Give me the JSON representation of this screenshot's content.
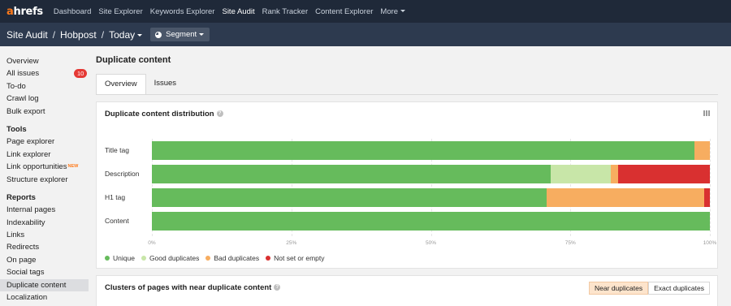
{
  "nav": {
    "logo_a": "a",
    "logo_rest": "hrefs",
    "links": [
      "Dashboard",
      "Site Explorer",
      "Keywords Explorer",
      "Site Audit",
      "Rank Tracker",
      "Content Explorer",
      "More"
    ]
  },
  "breadcrumb": {
    "root": "Site Audit",
    "project": "Hobpost",
    "date": "Today",
    "sep": "/"
  },
  "segment_label": "Segment",
  "sidebar": {
    "items": [
      "Overview",
      "All issues",
      "To-do",
      "Crawl log",
      "Bulk export"
    ],
    "issues_count": "10",
    "tools_heading": "Tools",
    "tools": [
      "Page explorer",
      "Link explorer",
      "Link opportunities",
      "Structure explorer"
    ],
    "new_tag": "NEW",
    "reports_heading": "Reports",
    "reports": [
      "Internal pages",
      "Indexability",
      "Links",
      "Redirects",
      "On page",
      "Social tags",
      "Duplicate content",
      "Localization"
    ]
  },
  "page": {
    "title": "Duplicate content",
    "tabs": [
      "Overview",
      "Issues"
    ]
  },
  "distribution": {
    "title": "Duplicate content distribution",
    "help": "?"
  },
  "chart_data": {
    "type": "bar",
    "orientation": "horizontal",
    "stacked": true,
    "categories": [
      "Title tag",
      "Description",
      "H1 tag",
      "Content"
    ],
    "series": [
      {
        "name": "Unique",
        "color": "#66bb5c",
        "values": [
          97.3,
          71.5,
          70.8,
          100
        ]
      },
      {
        "name": "Good duplicates",
        "color": "#c8e6a8",
        "values": [
          0,
          10.8,
          0,
          0
        ]
      },
      {
        "name": "Bad duplicates",
        "color": "#f7ad60",
        "values": [
          2.7,
          1.2,
          28.2,
          0
        ]
      },
      {
        "name": "Not set or empty",
        "color": "#d93030",
        "values": [
          0,
          16.5,
          1.0,
          0
        ]
      }
    ],
    "xticks": [
      "0%",
      "25%",
      "50%",
      "75%",
      "100%"
    ],
    "xlim": [
      0,
      100
    ]
  },
  "clusters": {
    "title": "Clusters of pages with near duplicate content",
    "help": "?",
    "toggle": [
      "Near duplicates",
      "Exact duplicates"
    ]
  }
}
